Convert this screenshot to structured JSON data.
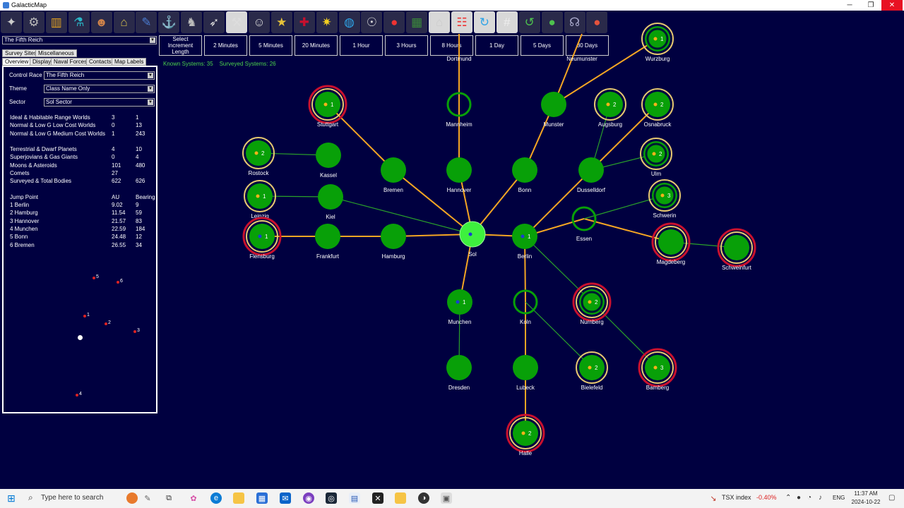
{
  "window": {
    "title": "GalacticMap",
    "minimize": "─",
    "restore": "❐",
    "close": "✕"
  },
  "toolbar_icons": [
    "system-view-icon",
    "ship-class-icon",
    "production-icon",
    "research-icon",
    "commander-icon",
    "industry-icon",
    "economics-icon",
    "naval-org-icon",
    "ground-forces-icon",
    "missile-icon",
    "class-design-icon",
    "officer-icon",
    "medal-icon",
    "race-flag-icon",
    "galactic-map-icon",
    "globe-icon",
    "species-icon",
    "intelligence-icon",
    "circuit-icon",
    "factory-icon",
    "calendar-icon",
    "refresh-icon",
    "grid-icon",
    "auto-turn-icon",
    "green-orb-icon",
    "alien-icon",
    "red-orb-icon"
  ],
  "race_select": "The Fifth Reich",
  "increments": {
    "label": "Select Increment Length",
    "buttons": [
      "2 Minutes",
      "5 Minutes",
      "20 Minutes",
      "1 Hour",
      "3 Hours",
      "8 Hours",
      "1 Day",
      "5 Days",
      "30 Days"
    ]
  },
  "status": {
    "known": "Known Systems: 35",
    "surveyed": "Surveyed Systems: 26"
  },
  "tabs_row1": [
    "Survey Sites",
    "Miscellaneous"
  ],
  "tabs_row2": [
    "Overview",
    "Display",
    "Naval Forces",
    "Contacts",
    "Map Labels"
  ],
  "overview": {
    "control_race_label": "Control Race",
    "control_race": "The Fifth Reich",
    "theme_label": "Theme",
    "theme": "Class Name Only",
    "sector_label": "Sector",
    "sector": "Sol Sector",
    "stats1": [
      {
        "label": "Ideal & Habitable Range Worlds",
        "a": "3",
        "b": "1"
      },
      {
        "label": "Normal & Low G Low Cost Worlds",
        "a": "0",
        "b": "13"
      },
      {
        "label": "Normal & Low G Medium Cost Worlds",
        "a": "1",
        "b": "243"
      }
    ],
    "stats2": [
      {
        "label": "Terrestrial & Dwarf Planets",
        "a": "4",
        "b": "10"
      },
      {
        "label": "Superjovians & Gas Giants",
        "a": "0",
        "b": "4"
      },
      {
        "label": "Moons & Asteroids",
        "a": "101",
        "b": "480"
      },
      {
        "label": "Comets",
        "a": "27",
        "b": ""
      },
      {
        "label": "Surveyed & Total Bodies",
        "a": "622",
        "b": "626"
      }
    ],
    "jump_header": {
      "label": "Jump Point",
      "a": "AU",
      "b": "Bearing"
    },
    "jump_points": [
      {
        "label": "1  Berlin",
        "a": "9.02",
        "b": "9"
      },
      {
        "label": "2  Hamburg",
        "a": "11.54",
        "b": "59"
      },
      {
        "label": "3  Hannover",
        "a": "21.57",
        "b": "83"
      },
      {
        "label": "4  Munchen",
        "a": "22.59",
        "b": "184"
      },
      {
        "label": "5  Bonn",
        "a": "24.48",
        "b": "12"
      },
      {
        "label": "6  Bremen",
        "a": "26.55",
        "b": "34"
      }
    ],
    "mini_labels": [
      "5",
      "6",
      "1",
      "2",
      "3",
      "4"
    ]
  },
  "systems": [
    {
      "name": "Dortmund",
      "marker": ""
    },
    {
      "name": "Neumunster",
      "marker": ""
    },
    {
      "name": "Wurzburg",
      "marker": "1"
    },
    {
      "name": "Stuttgart",
      "marker": "1"
    },
    {
      "name": "Mannheim",
      "marker": ""
    },
    {
      "name": "Munster",
      "marker": ""
    },
    {
      "name": "Augsburg",
      "marker": "2"
    },
    {
      "name": "Osnabruck",
      "marker": "2"
    },
    {
      "name": "Rostock",
      "marker": "2"
    },
    {
      "name": "Kassel",
      "marker": ""
    },
    {
      "name": "Bremen",
      "marker": ""
    },
    {
      "name": "Hannover",
      "marker": ""
    },
    {
      "name": "Bonn",
      "marker": ""
    },
    {
      "name": "Dusselldorf",
      "marker": ""
    },
    {
      "name": "Ulm",
      "marker": "2"
    },
    {
      "name": "Leipzig",
      "marker": "1"
    },
    {
      "name": "Kiel",
      "marker": ""
    },
    {
      "name": "Schwerin",
      "marker": "3"
    },
    {
      "name": "Flensburg",
      "marker": "1"
    },
    {
      "name": "Frankfurt",
      "marker": ""
    },
    {
      "name": "Hamburg",
      "marker": ""
    },
    {
      "name": "Sol",
      "marker": "4"
    },
    {
      "name": "Berlin",
      "marker": "1"
    },
    {
      "name": "Essen",
      "marker": ""
    },
    {
      "name": "Magdeberg",
      "marker": ""
    },
    {
      "name": "Schweinfurt",
      "marker": ""
    },
    {
      "name": "Munchen",
      "marker": "1"
    },
    {
      "name": "Koln",
      "marker": ""
    },
    {
      "name": "Nurnberg",
      "marker": "2"
    },
    {
      "name": "Dresden",
      "marker": ""
    },
    {
      "name": "Lubeck",
      "marker": ""
    },
    {
      "name": "Bielefeld",
      "marker": "2"
    },
    {
      "name": "Bamberg",
      "marker": "3"
    },
    {
      "name": "Halle",
      "marker": "2"
    }
  ],
  "colors": {
    "background": "#000040",
    "system_fill": "#08a008",
    "jump_survey": "#f5a623",
    "jump_unsurveyed": "#2aa02a",
    "pop_ring": "#e6c770",
    "hostile_ring": "#c8102e"
  },
  "taskbar": {
    "search_placeholder": "Type here to search",
    "tsx_label": "TSX index",
    "tsx_value": "-0.40%",
    "lang": "ENG",
    "time": "11:37 AM",
    "date": "2024-10-22"
  }
}
